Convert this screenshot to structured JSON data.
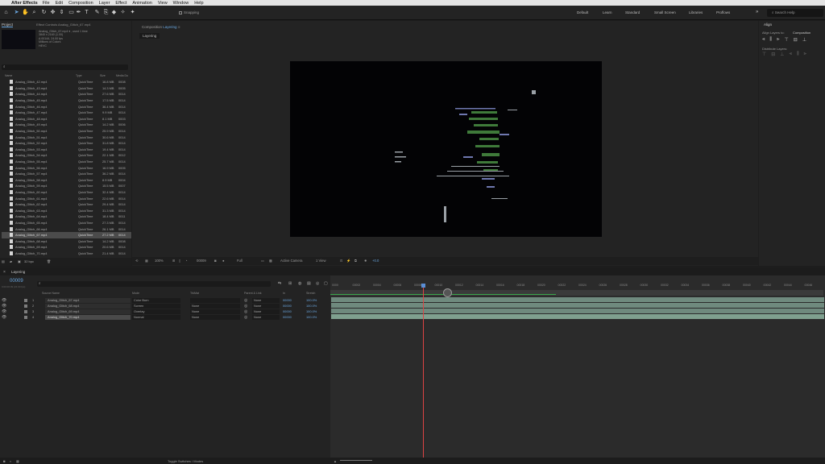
{
  "menubar": {
    "app": "After Effects",
    "items": [
      "File",
      "Edit",
      "Composition",
      "Layer",
      "Effect",
      "Animation",
      "View",
      "Window",
      "Help"
    ]
  },
  "toolbar": {
    "snapping": "Snapping",
    "workspaces": [
      "Default",
      "Learn",
      "Standard",
      "Small Screen",
      "Libraries",
      "Proflows"
    ],
    "search_placeholder": "Search Help"
  },
  "project": {
    "tab": "Project",
    "effect_tab": "Effect Controls Analog_Glitch_67.mp4",
    "selected_file": "Analog_Glitch_67.mp4 ▾ , used 1 time",
    "info_lines": [
      "3840 x 2160 (1.00)",
      "Δ 00144, 24.00 fps",
      "Millions of Colors",
      "HEVC"
    ],
    "columns": [
      "Name",
      "Type",
      "Size",
      "Media Du"
    ],
    "files": [
      {
        "name": "Analog_Glitch_42.mp4",
        "type": "QuickTime",
        "size": "16.8 MB",
        "dur": "0008"
      },
      {
        "name": "Analog_Glitch_43.mp4",
        "type": "QuickTime",
        "size": "14.3 MB",
        "dur": "0005"
      },
      {
        "name": "Analog_Glitch_44.mp4",
        "type": "QuickTime",
        "size": "27.6 MB",
        "dur": "0014"
      },
      {
        "name": "Analog_Glitch_45.mp4",
        "type": "QuickTime",
        "size": "17.5 MB",
        "dur": "0014"
      },
      {
        "name": "Analog_Glitch_46.mp4",
        "type": "QuickTime",
        "size": "36.4 MB",
        "dur": "0014"
      },
      {
        "name": "Analog_Glitch_47.mp4",
        "type": "QuickTime",
        "size": "9.9 MB",
        "dur": "0014"
      },
      {
        "name": "Analog_Glitch_48.mp4",
        "type": "QuickTime",
        "size": "8.1 MB",
        "dur": "0003"
      },
      {
        "name": "Analog_Glitch_49.mp4",
        "type": "QuickTime",
        "size": "14.2 MB",
        "dur": "0006"
      },
      {
        "name": "Analog_Glitch_50.mp4",
        "type": "QuickTime",
        "size": "25.9 MB",
        "dur": "0014"
      },
      {
        "name": "Analog_Glitch_51.mp4",
        "type": "QuickTime",
        "size": "30.6 MB",
        "dur": "0014"
      },
      {
        "name": "Analog_Glitch_52.mp4",
        "type": "QuickTime",
        "size": "31.8 MB",
        "dur": "0014"
      },
      {
        "name": "Analog_Glitch_53.mp4",
        "type": "QuickTime",
        "size": "19.4 MB",
        "dur": "0014"
      },
      {
        "name": "Analog_Glitch_54.mp4",
        "type": "QuickTime",
        "size": "22.1 MB",
        "dur": "0012"
      },
      {
        "name": "Analog_Glitch_55.mp4",
        "type": "QuickTime",
        "size": "25.7 MB",
        "dur": "0014"
      },
      {
        "name": "Analog_Glitch_56.mp4",
        "type": "QuickTime",
        "size": "16.9 MB",
        "dur": "0005"
      },
      {
        "name": "Analog_Glitch_57.mp4",
        "type": "QuickTime",
        "size": "36.2 MB",
        "dur": "0014"
      },
      {
        "name": "Analog_Glitch_58.mp4",
        "type": "QuickTime",
        "size": "8.9 MB",
        "dur": "0004"
      },
      {
        "name": "Analog_Glitch_59.mp4",
        "type": "QuickTime",
        "size": "15.5 MB",
        "dur": "0007"
      },
      {
        "name": "Analog_Glitch_60.mp4",
        "type": "QuickTime",
        "size": "32.4 MB",
        "dur": "0014"
      },
      {
        "name": "Analog_Glitch_61.mp4",
        "type": "QuickTime",
        "size": "22.6 MB",
        "dur": "0014"
      },
      {
        "name": "Analog_Glitch_62.mp4",
        "type": "QuickTime",
        "size": "29.4 MB",
        "dur": "0014"
      },
      {
        "name": "Analog_Glitch_63.mp4",
        "type": "QuickTime",
        "size": "31.3 MB",
        "dur": "0014"
      },
      {
        "name": "Analog_Glitch_64.mp4",
        "type": "QuickTime",
        "size": "18.4 MB",
        "dur": "0011"
      },
      {
        "name": "Analog_Glitch_65.mp4",
        "type": "QuickTime",
        "size": "27.3 MB",
        "dur": "0014"
      },
      {
        "name": "Analog_Glitch_66.mp4",
        "type": "QuickTime",
        "size": "26.1 MB",
        "dur": "0014"
      },
      {
        "name": "Analog_Glitch_67.mp4",
        "type": "QuickTime",
        "size": "27.2 MB",
        "dur": "0014",
        "selected": true
      },
      {
        "name": "Analog_Glitch_68.mp4",
        "type": "QuickTime",
        "size": "14.2 MB",
        "dur": "0008"
      },
      {
        "name": "Analog_Glitch_69.mp4",
        "type": "QuickTime",
        "size": "20.6 MB",
        "dur": "0014"
      },
      {
        "name": "Analog_Glitch_70.mp4",
        "type": "QuickTime",
        "size": "21.4 MB",
        "dur": "0014"
      }
    ],
    "bpc": "32 bpc"
  },
  "composition": {
    "tab_prefix": "Composition",
    "tab_name": "Layering",
    "subtab": "Layering",
    "footer": {
      "zoom": "100%",
      "timecode": "00009",
      "resolution": "Full",
      "camera": "Active Camera",
      "view": "1 View",
      "exposure": "+0.0"
    }
  },
  "align": {
    "tab": "Align",
    "align_layers_to_label": "Align Layers to:",
    "align_layers_to_value": "Composition",
    "distribute_label": "Distribute Layers:"
  },
  "timeline": {
    "tab": "Layering",
    "current_time": "00009",
    "fps_note": "0:00:00:09 (24.00 fps)",
    "col_headers": {
      "source": "Source Name",
      "mode": "Mode",
      "trkmat": "TrkMat",
      "parent": "Parent & Link",
      "in": "In",
      "stretch": "Stretch"
    },
    "layers": [
      {
        "num": "1",
        "name": "Analog_Glitch_67.mp4",
        "mode": "Color Burn",
        "trk": "",
        "parent": "None",
        "in": "00000",
        "stretch": "100.0%"
      },
      {
        "num": "2",
        "name": "Analog_Glitch_68.mp4",
        "mode": "Screen",
        "trk": "None",
        "parent": "None",
        "in": "00000",
        "stretch": "100.0%"
      },
      {
        "num": "3",
        "name": "Analog_Glitch_69.mp4",
        "mode": "Overlay",
        "trk": "None",
        "parent": "None",
        "in": "00000",
        "stretch": "100.0%"
      },
      {
        "num": "4",
        "name": "Analog_Glitch_70.mp4",
        "mode": "Normal",
        "trk": "None",
        "parent": "None",
        "in": "00000",
        "stretch": "100.0%",
        "selected": true
      }
    ],
    "ruler": [
      "0000",
      "00002",
      "00004",
      "00006",
      "00008",
      "00010",
      "00012",
      "00014",
      "00016",
      "00018",
      "00020",
      "00022",
      "00024",
      "00026",
      "00028",
      "00030",
      "00032",
      "00034",
      "00036",
      "00038",
      "00040",
      "00042",
      "00044",
      "00046"
    ],
    "toggle_label": "Toggle Switches / Modes"
  }
}
